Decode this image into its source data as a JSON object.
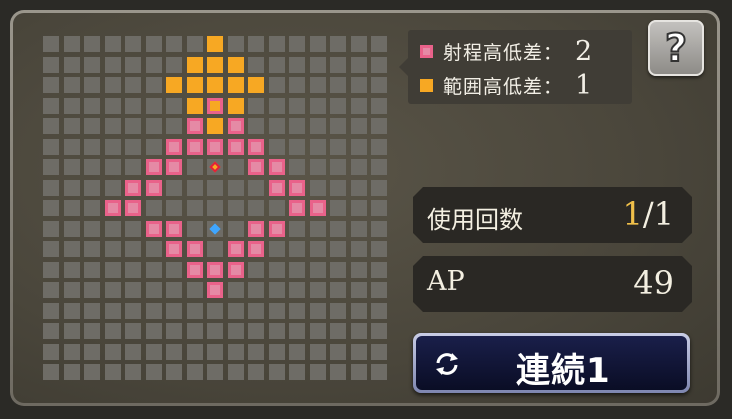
{
  "legend": {
    "range_height": {
      "label": "射程高低差：",
      "value": "2",
      "color": "#e9628a"
    },
    "area_height": {
      "label": "範囲高低差：",
      "value": "1",
      "color": "#f7a823"
    }
  },
  "help_button": {
    "label": "?"
  },
  "stats": {
    "uses": {
      "label": "使用回数",
      "current": "1",
      "separator": "/",
      "max": "1"
    },
    "ap": {
      "label": "AP",
      "value": "49"
    }
  },
  "action_button": {
    "label": "連続1",
    "icon": "repeat-icon"
  },
  "grid": {
    "size": 17,
    "center_cell": [
      8,
      9
    ],
    "target_cell": [
      8,
      6
    ],
    "range_cells": [
      [
        8,
        3
      ],
      [
        7,
        4
      ],
      [
        9,
        4
      ],
      [
        6,
        5
      ],
      [
        7,
        5
      ],
      [
        8,
        5
      ],
      [
        9,
        5
      ],
      [
        10,
        5
      ],
      [
        5,
        6
      ],
      [
        6,
        6
      ],
      [
        10,
        6
      ],
      [
        11,
        6
      ],
      [
        4,
        7
      ],
      [
        5,
        7
      ],
      [
        11,
        7
      ],
      [
        12,
        7
      ],
      [
        4,
        8
      ],
      [
        12,
        8
      ],
      [
        5,
        9
      ],
      [
        6,
        9
      ],
      [
        10,
        9
      ],
      [
        11,
        9
      ],
      [
        6,
        10
      ],
      [
        7,
        10
      ],
      [
        9,
        10
      ],
      [
        10,
        10
      ],
      [
        7,
        11
      ],
      [
        8,
        11
      ],
      [
        9,
        11
      ],
      [
        8,
        12
      ],
      [
        3,
        8
      ],
      [
        13,
        8
      ]
    ],
    "area_cells": [
      [
        8,
        0
      ],
      [
        7,
        1
      ],
      [
        8,
        1
      ],
      [
        9,
        1
      ],
      [
        6,
        2
      ],
      [
        7,
        2
      ],
      [
        8,
        2
      ],
      [
        9,
        2
      ],
      [
        10,
        2
      ],
      [
        7,
        3
      ],
      [
        8,
        3
      ],
      [
        9,
        3
      ],
      [
        8,
        4
      ]
    ]
  },
  "colors": {
    "grid_cell": "#6e6c66",
    "range": "#e9628a",
    "area": "#f7a823",
    "target_marker": "#e0203a",
    "center_marker": "#3fa6ff"
  }
}
